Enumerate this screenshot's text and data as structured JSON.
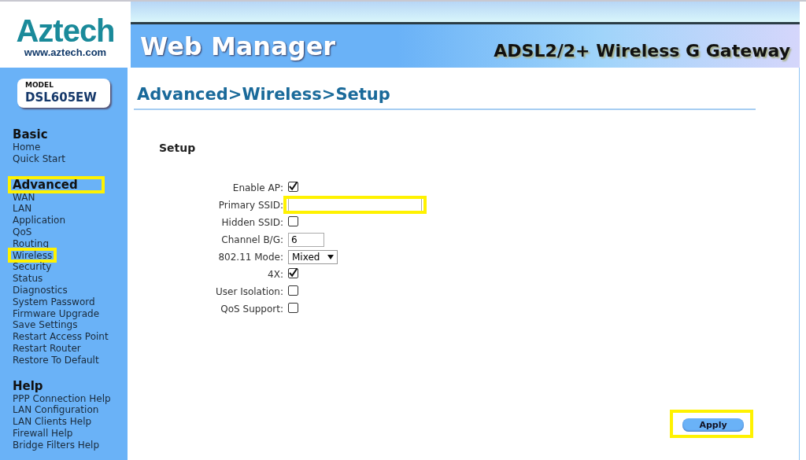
{
  "header": {
    "logo": "Aztech",
    "logo_url": "www.aztech.com",
    "title": "Web Manager",
    "product": "ADSL2/2+ Wireless G Gateway"
  },
  "model": {
    "label": "MODEL",
    "name": "DSL605EW"
  },
  "sidebar": {
    "sections": [
      {
        "title": "Basic",
        "highlighted": false,
        "items": [
          {
            "label": "Home",
            "highlighted": false
          },
          {
            "label": "Quick Start",
            "highlighted": false
          }
        ]
      },
      {
        "title": "Advanced",
        "highlighted": true,
        "items": [
          {
            "label": "WAN",
            "highlighted": false
          },
          {
            "label": "LAN",
            "highlighted": false
          },
          {
            "label": "Application",
            "highlighted": false
          },
          {
            "label": "QoS",
            "highlighted": false
          },
          {
            "label": "Routing",
            "highlighted": false
          },
          {
            "label": "Wireless",
            "highlighted": true
          },
          {
            "label": "Security",
            "highlighted": false
          },
          {
            "label": "Status",
            "highlighted": false
          },
          {
            "label": "Diagnostics",
            "highlighted": false
          },
          {
            "label": "System Password",
            "highlighted": false
          },
          {
            "label": "Firmware Upgrade",
            "highlighted": false
          },
          {
            "label": "Save Settings",
            "highlighted": false
          },
          {
            "label": "Restart Access Point",
            "highlighted": false
          },
          {
            "label": "Restart Router",
            "highlighted": false
          },
          {
            "label": "Restore To Default",
            "highlighted": false
          }
        ]
      },
      {
        "title": "Help",
        "highlighted": false,
        "items": [
          {
            "label": "PPP Connection Help",
            "highlighted": false
          },
          {
            "label": "LAN Configuration",
            "highlighted": false
          },
          {
            "label": "LAN Clients Help",
            "highlighted": false
          },
          {
            "label": "Firewall Help",
            "highlighted": false
          },
          {
            "label": "Bridge Filters Help",
            "highlighted": false
          }
        ]
      }
    ]
  },
  "page_title": "Advanced>Wireless>Setup",
  "section_title": "Setup",
  "fields": [
    {
      "kind": "checkbox",
      "label": "Enable AP:",
      "checked": true,
      "highlighted": false
    },
    {
      "kind": "text",
      "label": "Primary SSID:",
      "highlighted": true
    },
    {
      "kind": "checkbox",
      "label": "Hidden SSID:",
      "checked": false,
      "highlighted": false
    },
    {
      "kind": "text",
      "label": "Channel B/G:",
      "value": "6",
      "highlighted": false
    },
    {
      "kind": "select",
      "label": "802.11 Mode:",
      "value": "Mixed",
      "highlighted": false
    },
    {
      "kind": "checkbox",
      "label": "4X:",
      "checked": true,
      "highlighted": false
    },
    {
      "kind": "checkbox",
      "label": "User Isolation:",
      "checked": false,
      "highlighted": false
    },
    {
      "kind": "checkbox",
      "label": "QoS Support:",
      "checked": false,
      "highlighted": false
    }
  ],
  "apply_button": {
    "label": "Apply",
    "highlighted": true
  }
}
